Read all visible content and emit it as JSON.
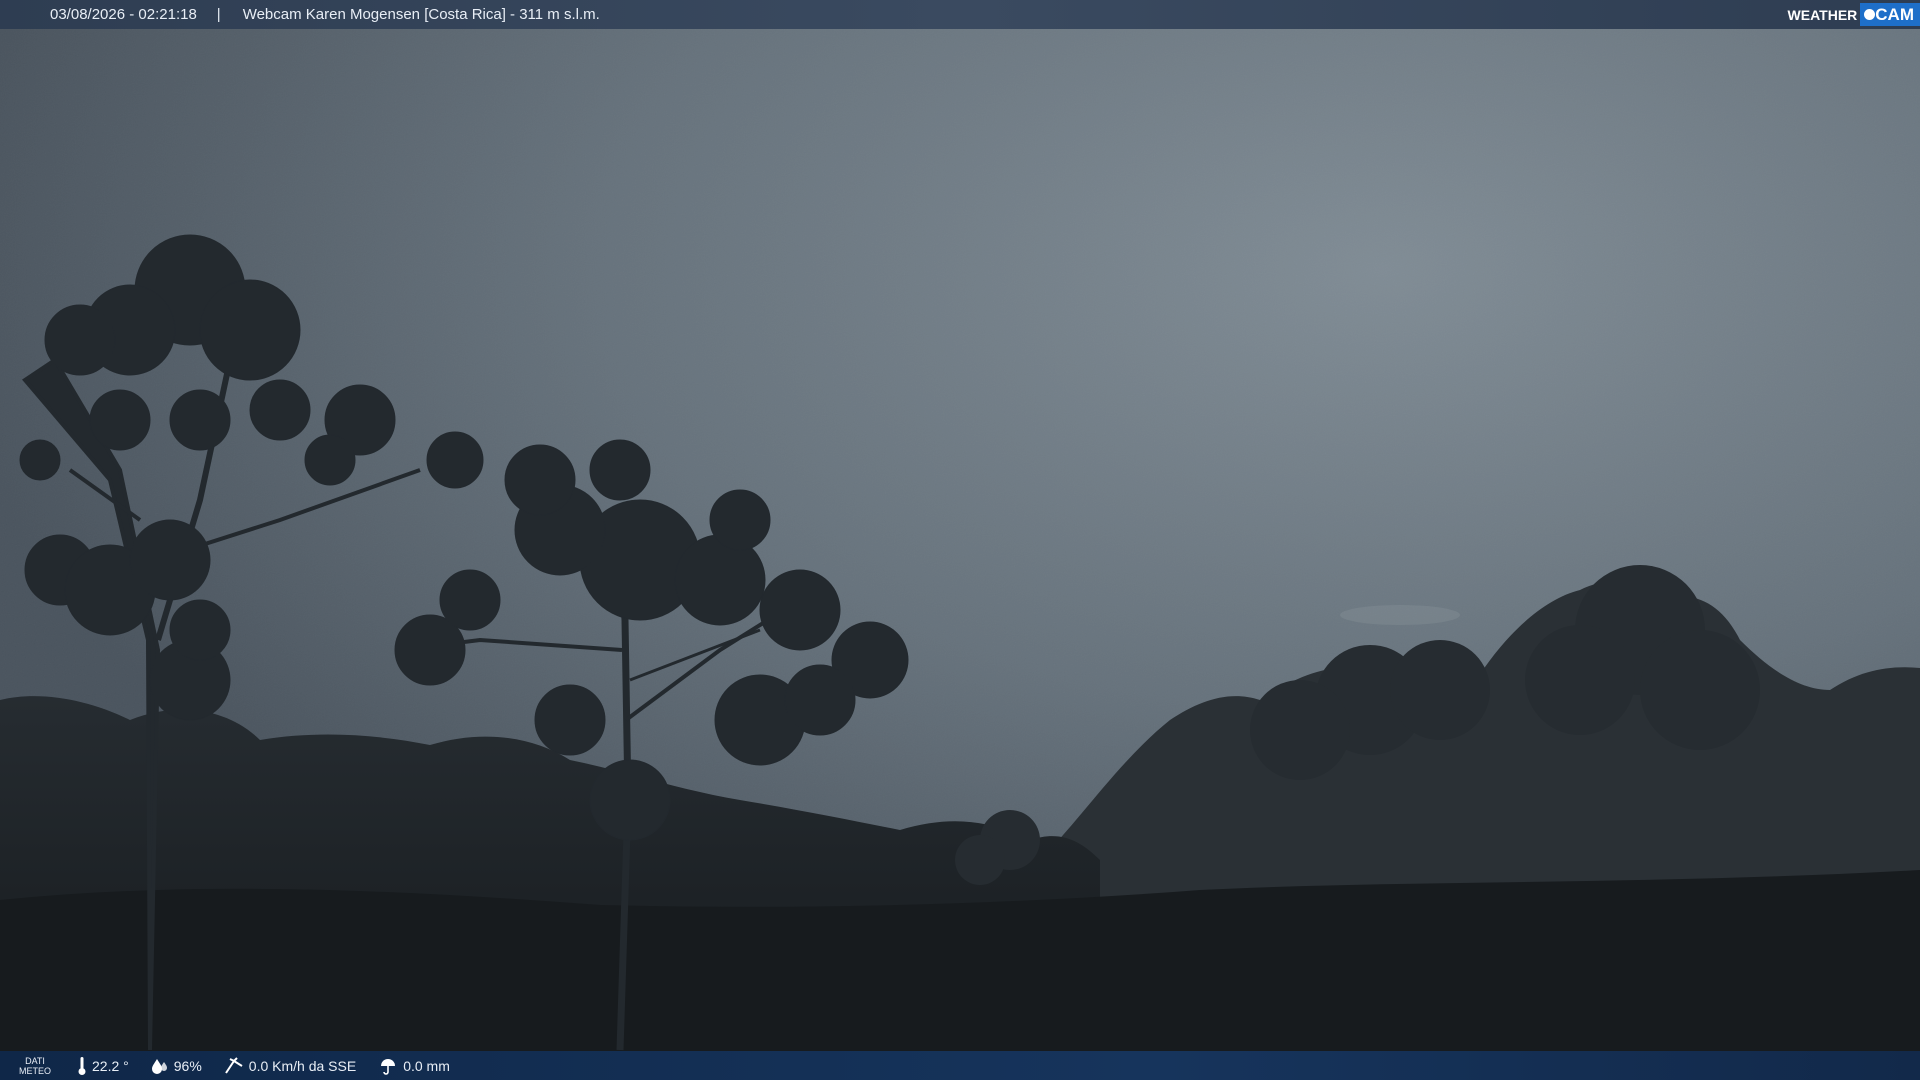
{
  "header": {
    "datetime": "03/08/2026 - 02:21:18",
    "separator": "|",
    "title": "Webcam Karen Mogensen [Costa Rica]  - 311 m s.l.m."
  },
  "logo": {
    "weather": "WEATHER",
    "cam": "CAM"
  },
  "footer": {
    "dati_line1": "DATI",
    "dati_line2": "METEO",
    "temperature": "22.2 °",
    "humidity": "96%",
    "wind": "0.0 Km/h da SSE",
    "rain": "0.0 mm"
  },
  "colors": {
    "sky": "#6f7c86",
    "forest": "#1d2226",
    "header_bg": "#33445a",
    "footer_bg": "#13305a",
    "logo_blue": "#1e6fc9"
  },
  "icons": {
    "temperature": "thermometer-icon",
    "humidity": "humidity-drops-icon",
    "wind": "wind-icon",
    "rain": "rain-icon"
  }
}
